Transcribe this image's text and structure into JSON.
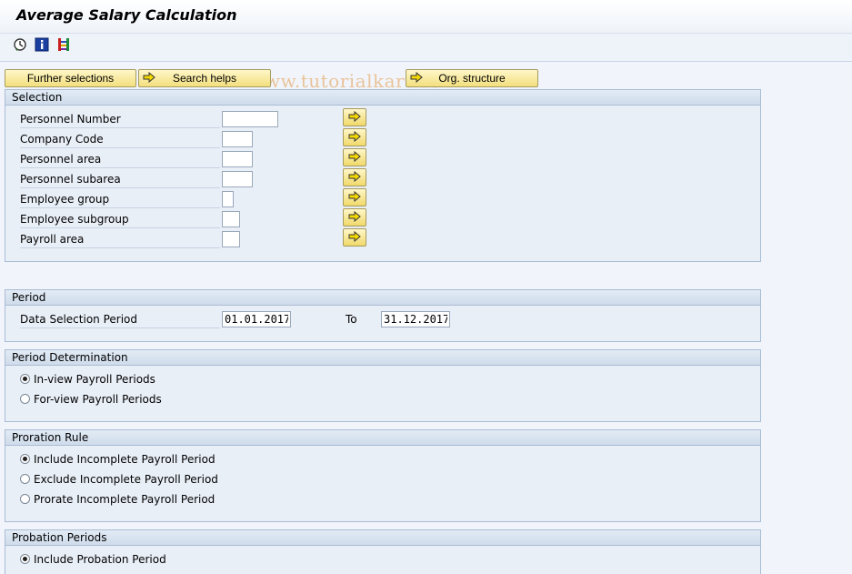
{
  "window": {
    "title": "Average Salary Calculation"
  },
  "watermark": "© www.tutorialkart.com",
  "toolbar": {
    "buttons": [
      {
        "icon": "execute-clock-icon"
      },
      {
        "icon": "info-icon"
      },
      {
        "icon": "selection-screen-icon"
      }
    ]
  },
  "top_buttons": {
    "further_selections": "Further selections",
    "search_helps": "Search helps",
    "org_structure": "Org. structure"
  },
  "selection": {
    "header": "Selection",
    "fields": [
      {
        "label": "Personnel Number",
        "value": ""
      },
      {
        "label": "Company Code",
        "value": ""
      },
      {
        "label": "Personnel area",
        "value": ""
      },
      {
        "label": "Personnel subarea",
        "value": ""
      },
      {
        "label": "Employee group",
        "value": ""
      },
      {
        "label": "Employee subgroup",
        "value": ""
      },
      {
        "label": "Payroll area",
        "value": ""
      }
    ]
  },
  "period": {
    "header": "Period",
    "label": "Data Selection Period",
    "from": "01.01.2017",
    "to_label": "To",
    "to": "31.12.2017"
  },
  "period_determination": {
    "header": "Period Determination",
    "options": [
      {
        "label": "In-view Payroll Periods",
        "selected": true
      },
      {
        "label": "For-view Payroll Periods",
        "selected": false
      }
    ]
  },
  "proration_rule": {
    "header": "Proration Rule",
    "options": [
      {
        "label": "Include Incomplete Payroll Period",
        "selected": true
      },
      {
        "label": "Exclude Incomplete Payroll Period",
        "selected": false
      },
      {
        "label": "Prorate Incomplete Payroll Period",
        "selected": false
      }
    ]
  },
  "probation_periods": {
    "header": "Probation Periods",
    "options": [
      {
        "label": "Include Probation Period",
        "selected": true
      }
    ]
  }
}
